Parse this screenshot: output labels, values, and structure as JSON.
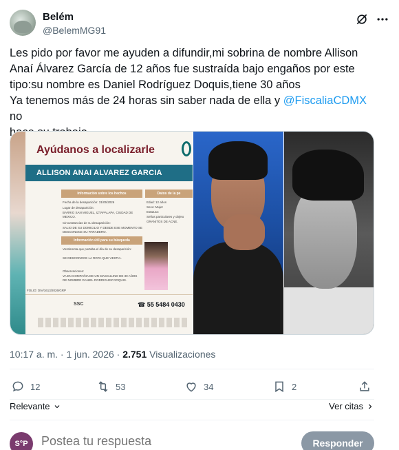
{
  "author": {
    "name": "Belém",
    "handle": "@BelemMG91"
  },
  "tweet": {
    "line1": "Les pido por favor me ayuden a difundir,mi sobrina de nombre Allison",
    "line2": "Anaí Álvarez García de 12 años fue sustraída bajo engaños por este",
    "line3": "tipo:su nombre es Daniel Rodríguez Doquis,tiene 30 años",
    "line4_pre": "Ya tenemos más de 24 horas sin saber nada de ella y ",
    "mention": "@FiscaliaCDMX",
    "line4_post": " no",
    "line5": "hace su trabajo"
  },
  "poster": {
    "title": "Ayúdanos a localizarle",
    "name_bar": "ALLISON ANAI ALVAREZ GARCIA",
    "section_facts": "Información sobre los hechos",
    "section_data": "Datos de la pe",
    "fact_date": "Fecha de la desaparición: 31/05/2026",
    "fact_place": "Lugar de desaparición:",
    "fact_place_value": "BARRIO SAN MIGUEL, IZTAPALAPA, CIUDAD DE MEXICO.",
    "fact_circ": "Circunstancias de su desaparición:",
    "fact_circ_value": "SALIO DE SU DOMICILIO Y DESDE ESE MOMENTO SE DESCONOCE SU PARADERO.",
    "data_age": "Edad: 12 años",
    "data_sex": "Sexo: Mujer",
    "data_height": "Estatura:",
    "data_marks": "Señas particulares y objeto",
    "data_marks_value": "GRANITOS DE ACNE.",
    "section_search": "Información útil para su búsqueda",
    "clothes": "Vestimenta que portaba el día de su desaparición:",
    "clothes_value": "SE DESCONOCE LA ROPA QUE VESTIA.",
    "obs": "Observaciones:",
    "obs_value": "VA EN COMPAÑIA DE UN MASCULINO DE 30 AÑOS DE NOMBRE DANIEL RODRIGUEZ DOQUIS.",
    "folio": "FOLIO: DIV/1613/2026/GRP",
    "ssc": "SSC",
    "phone": "55 5484 0430"
  },
  "meta": {
    "time": "10:17 a. m. · 1 jun. 2026 · ",
    "views_count": "2.751",
    "views_label": " Visualizaciones"
  },
  "actions": {
    "replies": "12",
    "reposts": "53",
    "likes": "34",
    "bookmarks": "2"
  },
  "sort": {
    "label": "Relevante",
    "quotes": "Ver citas"
  },
  "reply": {
    "placeholder": "Postea tu respuesta",
    "button": "Responder",
    "avatar_text": "S°P"
  },
  "colors": {
    "accent": "#1d9bf0",
    "text": "#0f1419",
    "muted": "#536471",
    "reply_button": "#8b98a5"
  },
  "icons": {
    "grok": "grok-icon",
    "more": "more-icon",
    "reply": "reply-icon",
    "repost": "repost-icon",
    "like": "heart-icon",
    "bookmark": "bookmark-icon",
    "share": "share-icon"
  }
}
